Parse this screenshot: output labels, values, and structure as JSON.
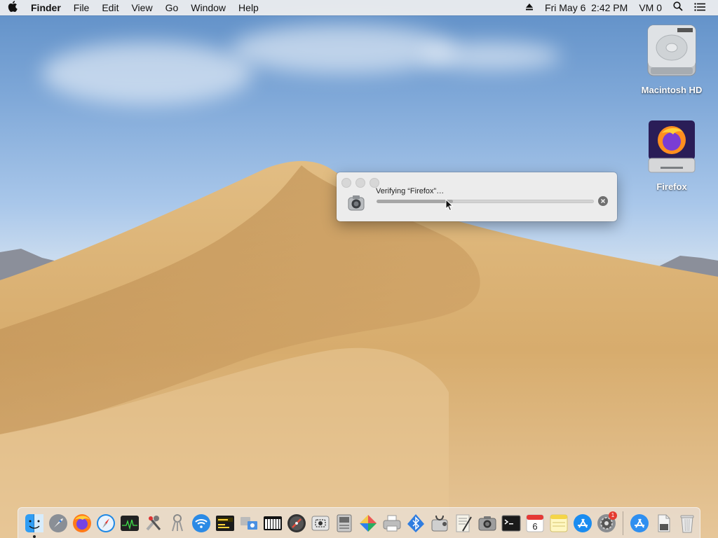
{
  "menubar": {
    "app_name": "Finder",
    "menus": [
      "File",
      "Edit",
      "View",
      "Go",
      "Window",
      "Help"
    ],
    "clock": "Fri May 6  2:42 PM",
    "user": "VM 0"
  },
  "desktop_icons": [
    {
      "label": "Macintosh HD",
      "icon": "hard-drive-icon"
    },
    {
      "label": "Firefox",
      "icon": "firefox-disk-image-icon"
    }
  ],
  "dialog": {
    "title": "Verifying “Firefox”…",
    "progress": 0.35
  },
  "dock": {
    "items": [
      {
        "name": "finder",
        "running": true
      },
      {
        "name": "launchpad"
      },
      {
        "name": "firefox"
      },
      {
        "name": "safari"
      },
      {
        "name": "activity-monitor"
      },
      {
        "name": "system-information"
      },
      {
        "name": "keychain-access"
      },
      {
        "name": "wireless-diagnostics"
      },
      {
        "name": "console"
      },
      {
        "name": "migration-assistant"
      },
      {
        "name": "midi-setup"
      },
      {
        "name": "directory-utility"
      },
      {
        "name": "screenshot"
      },
      {
        "name": "boot-camp-assistant"
      },
      {
        "name": "colorsync-utility"
      },
      {
        "name": "print-center"
      },
      {
        "name": "bluetooth-file-exchange"
      },
      {
        "name": "disk-utility"
      },
      {
        "name": "script-editor"
      },
      {
        "name": "screenshot-camera"
      },
      {
        "name": "terminal"
      },
      {
        "name": "calendar",
        "day": "6"
      },
      {
        "name": "notes"
      },
      {
        "name": "app-store"
      },
      {
        "name": "system-preferences",
        "badge": "1"
      }
    ],
    "right_items": [
      {
        "name": "applications-folder"
      },
      {
        "name": "documents"
      },
      {
        "name": "trash"
      }
    ]
  }
}
